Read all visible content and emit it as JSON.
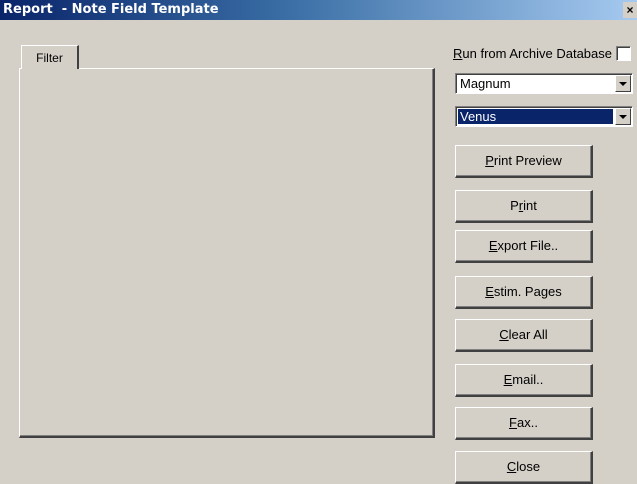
{
  "window": {
    "title": "Report  - Note Field Template",
    "close_glyph": "×"
  },
  "tabs": [
    {
      "label": "Filter"
    }
  ],
  "archive": {
    "label_pre": "",
    "label_accel": "R",
    "label_post": "un from Archive Database",
    "checked": false
  },
  "selects": {
    "server": {
      "value": "Magnum"
    },
    "database": {
      "value": "Venus"
    }
  },
  "buttons": {
    "print_preview": {
      "pre": "",
      "accel": "P",
      "post": "rint Preview"
    },
    "print": {
      "pre": "P",
      "accel": "r",
      "post": "int"
    },
    "export_file": {
      "pre": "",
      "accel": "E",
      "post": "xport File.."
    },
    "estim_pages": {
      "pre": "",
      "accel": "E",
      "post": "stim. Pages"
    },
    "clear_all": {
      "pre": "",
      "accel": "C",
      "post": "lear All"
    },
    "email": {
      "pre": "",
      "accel": "E",
      "post": "mail.."
    },
    "fax": {
      "pre": "",
      "accel": "F",
      "post": "ax.."
    },
    "close": {
      "pre": "",
      "accel": "C",
      "post": "lose"
    }
  },
  "colors": {
    "face": "#d4d0c8",
    "title_start": "#0a246a",
    "title_end": "#a6caf0",
    "selection": "#0a246a"
  }
}
